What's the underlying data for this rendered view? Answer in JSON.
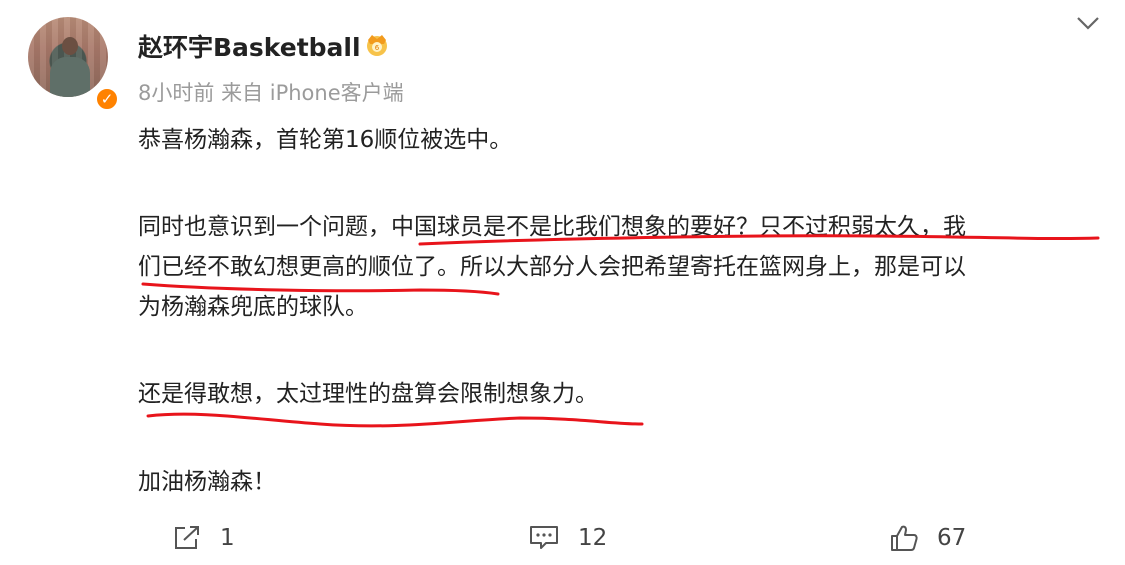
{
  "post": {
    "author": "赵环宇Basketball",
    "time": "8小时前",
    "source": "来自 iPhone客户端",
    "paragraphs": {
      "p1": "恭喜杨瀚森，首轮第16顺位被选中。",
      "p2_line1": "同时也意识到一个问题，中国球员是不是比我们想象的要好？只不过积弱太久，我",
      "p2_line2": "们已经不敢幻想更高的顺位了。所以大部分人会把希望寄托在篮网身上，那是可以",
      "p2_line3": "为杨瀚森兜底的球队。",
      "p3": "还是得敢想，太过理性的盘算会限制想象力。",
      "p4": "加油杨瀚森！"
    }
  },
  "actions": {
    "share_count": "1",
    "comment_count": "12",
    "like_count": "67"
  },
  "colors": {
    "verified": "#ff8200",
    "underline": "#e8141b",
    "meta": "#9b9b9b"
  },
  "icons": [
    "chevron-down-icon",
    "crown-badge-icon",
    "verified-icon",
    "share-icon",
    "comment-icon",
    "like-icon"
  ]
}
